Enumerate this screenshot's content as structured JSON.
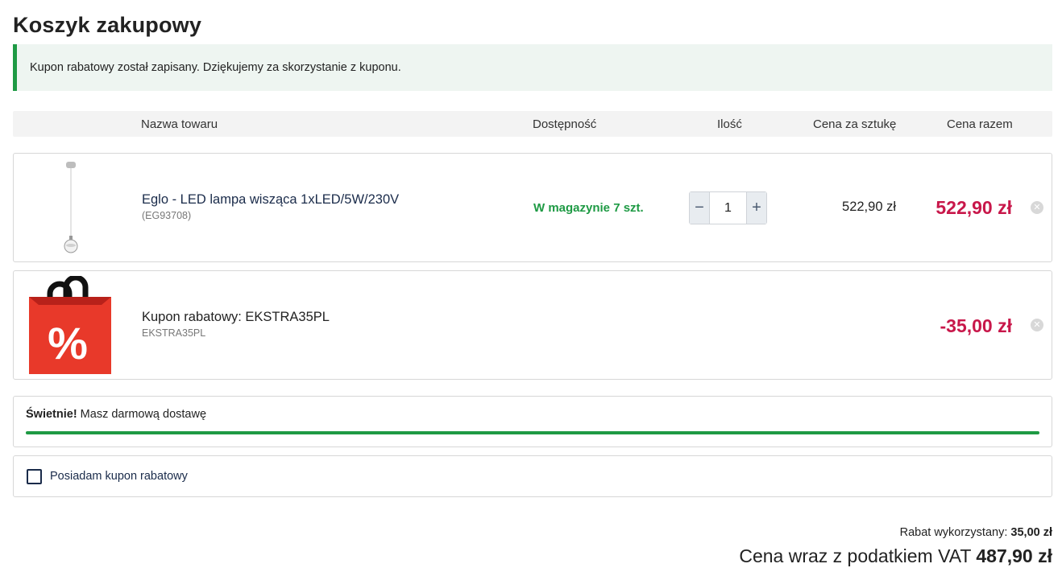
{
  "page": {
    "title": "Koszyk zakupowy"
  },
  "alert": {
    "text": "Kupon rabatowy został zapisany. Dziękujemy za skorzystanie z kuponu."
  },
  "table": {
    "headers": {
      "name": "Nazwa towaru",
      "availability": "Dostępność",
      "quantity": "Ilość",
      "unit_price": "Cena za sztukę",
      "total": "Cena razem"
    }
  },
  "items": [
    {
      "name": "Eglo - LED lampa wisząca 1xLED/5W/230V",
      "code": "(EG93708)",
      "availability": "W magazynie 7 szt.",
      "quantity": "1",
      "unit_price": "522,90 zł",
      "total": "522,90 zł",
      "thumbnail_icon": "pendant-lamp-icon"
    },
    {
      "name": "Kupon rabatowy: EKSTRA35PL",
      "code": "EKSTRA35PL",
      "total": "-35,00 zł",
      "thumbnail_icon": "discount-bag-icon",
      "badge_symbol": "%"
    }
  ],
  "shipping": {
    "bold": "Świetnie!",
    "text": " Masz darmową dostawę",
    "progress_percent": 100
  },
  "coupon_toggle": {
    "label": "Posiadam kupon rabatowy",
    "checked": false
  },
  "summary": {
    "discount_label": "Rabat wykorzystany: ",
    "discount_value": "35,00 zł",
    "total_label": "Cena wraz z podatkiem VAT ",
    "total_value": "487,90 zł"
  },
  "colors": {
    "accent_green": "#1e9a44",
    "price_red": "#c8174a",
    "bag_red": "#e8392a"
  },
  "icons": {
    "minus": "−",
    "plus": "+",
    "remove": "✕"
  }
}
